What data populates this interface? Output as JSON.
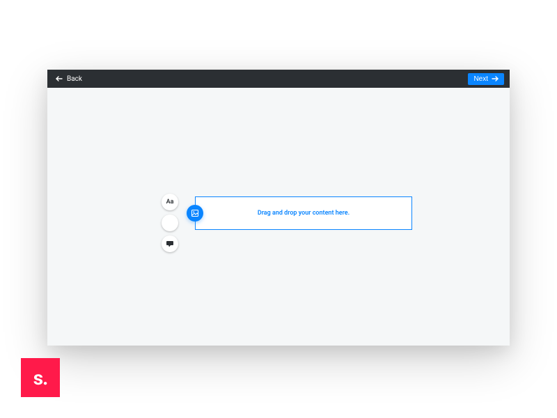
{
  "header": {
    "back_label": "Back",
    "next_label": "Next"
  },
  "tools": {
    "text_label": "Aa"
  },
  "dropzone": {
    "placeholder": "Drag and drop your content here."
  },
  "logo": {
    "text": "s."
  },
  "colors": {
    "accent": "#0a85ff",
    "header_bg": "#2b2f33",
    "canvas_bg": "#f5f7f8",
    "logo_bg": "#ff1a4a"
  }
}
